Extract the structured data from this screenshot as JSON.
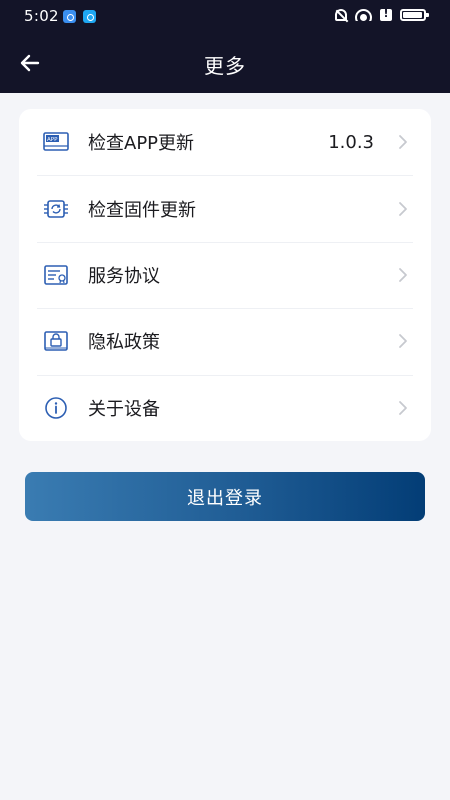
{
  "status_bar": {
    "time": "5:02",
    "left_icons": [
      "browser-icon",
      "search-app-icon"
    ],
    "right_icons": [
      "bell-off-icon",
      "wifi-icon",
      "alert-icon",
      "battery-icon"
    ]
  },
  "header": {
    "title": "更多",
    "back_icon": "arrow-left-icon",
    "background_color": "#131428"
  },
  "menu": {
    "items": [
      {
        "label": "检查APP更新",
        "value": "1.0.3",
        "icon": "app-update-icon"
      },
      {
        "label": "检查固件更新",
        "value": "",
        "icon": "firmware-chip-icon"
      },
      {
        "label": "服务协议",
        "value": "",
        "icon": "service-agreement-icon"
      },
      {
        "label": "隐私政策",
        "value": "",
        "icon": "privacy-policy-icon"
      },
      {
        "label": "关于设备",
        "value": "",
        "icon": "info-icon"
      }
    ]
  },
  "logout": {
    "label": "退出登录"
  },
  "colors": {
    "page_background": "#f4f5f9",
    "card_background": "#ffffff",
    "icon_accent": "#2d5fb3",
    "button_gradient_start": "#3a7cb2",
    "button_gradient_end": "#033d76"
  }
}
